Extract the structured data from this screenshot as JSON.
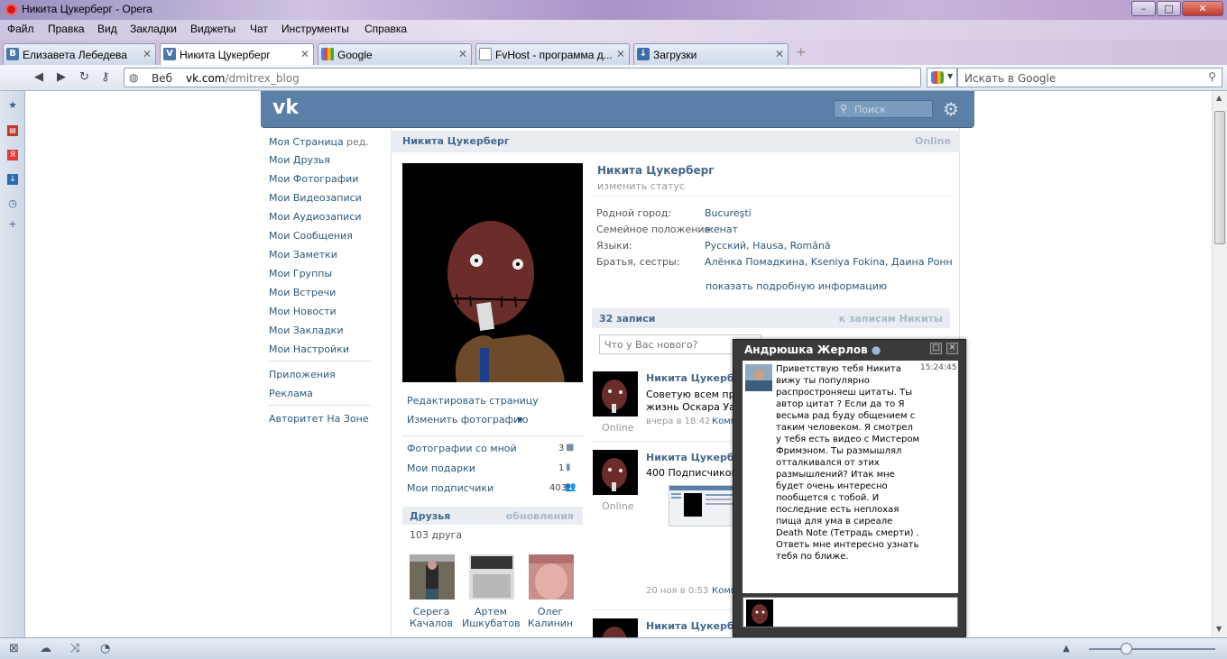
{
  "window": {
    "title": "Никита Цукерберг - Opera"
  },
  "menu": [
    "Файл",
    "Правка",
    "Вид",
    "Закладки",
    "Виджеты",
    "Чат",
    "Инструменты",
    "Справка"
  ],
  "tabs": [
    {
      "label": "Елизавета Лебедева",
      "icon": "vk-icon"
    },
    {
      "label": "Никита Цукерберг",
      "icon": "vk-icon"
    },
    {
      "label": "Google",
      "icon": "google-icon"
    },
    {
      "label": "FvHost - программа д...",
      "icon": "page-icon"
    },
    {
      "label": "Загрузки",
      "icon": "downloads-icon"
    }
  ],
  "address": {
    "web_label": "Веб",
    "url_host": "vk.com",
    "url_path": "/dmitrex_blog"
  },
  "search": {
    "placeholder": "Искать в Google"
  },
  "vk": {
    "logo": "vk",
    "search_placeholder": "Поиск",
    "nav": [
      "Моя Страница",
      "Мои Друзья",
      "Мои Фотографии",
      "Мои Видеозаписи",
      "Мои Аудиозаписи",
      "Мои Сообщения",
      "Мои Заметки",
      "Мои Группы",
      "Мои Встречи",
      "Мои Новости",
      "Мои Закладки",
      "Мои Настройки"
    ],
    "nav_edit": "ред.",
    "nav_extra": [
      "Приложения",
      "Реклама"
    ],
    "nav_group": "Авторитет На Зоне",
    "page_name": "Никита Цукерберг",
    "online": "Online",
    "profile_actions": [
      "Редактировать страницу",
      "Изменить фотографию"
    ],
    "photo_links": [
      {
        "label": "Фотографии со мной",
        "count": "3"
      },
      {
        "label": "Мои подарки",
        "count": "1"
      },
      {
        "label": "Мои подписчики",
        "count": "403"
      }
    ],
    "friends": {
      "title": "Друзья",
      "updates": "обновления",
      "count": "103 друга",
      "list": [
        {
          "first": "Серега",
          "last": "Качалов"
        },
        {
          "first": "Артем",
          "last": "Ишкубатов"
        },
        {
          "first": "Олег",
          "last": "Калинин"
        }
      ]
    },
    "profile": {
      "name": "Никита Цукерберг",
      "status": "изменить статус",
      "info": [
        {
          "label": "Родной город:",
          "value": "Bucureşti"
        },
        {
          "label": "Семейное положение:",
          "value": "женат"
        },
        {
          "label": "Языки:",
          "value": "Русский, Hausa, Română"
        },
        {
          "label": "Братья, сестры:",
          "value": "Алёнка Помадкина, Kseniya Fokina, Даина Ронн"
        }
      ],
      "more": "показать подробную информацию"
    },
    "wall": {
      "count": "32 записи",
      "link": "к записям Никиты",
      "input_placeholder": "Что у Вас нового?",
      "posts": [
        {
          "author": "Никита Цукерберг",
          "line1": "Советую всем прочит",
          "line2": "жизнь Оскара Уао»",
          "meta": "вчера в 18:42",
          "comments": "Комме",
          "online": "Online"
        },
        {
          "author": "Никита Цукерберг",
          "line1": "400 Подписчиков!",
          "line2": "",
          "meta": "20 ноя в 0:53",
          "comments": "Комме",
          "online": "Online"
        },
        {
          "author": "Никита Цукерберг",
          "line1": "",
          "line2": "",
          "meta": "",
          "comments": "",
          "online": ""
        }
      ]
    }
  },
  "chat": {
    "contact": "Андрюшка Жерлов",
    "time": "15:24:45",
    "message": "Приветствую тебя Никита вижу ты популярно распростроняеш цитаты. Ты автор цитат ? Если да то Я весьма рад буду общением с таким человеком. Я смотрел у тебя есть видео с Мистером Фримэном. Ты размышлял отталкивался от этих размышлений? Итак мне будет очень интересно пообщется с тобой. И последние есть неплохая пища для ума в сиреале Death Note (Тетрадь смерти) . Ответь мне интересно узнать тебя по ближе."
  }
}
